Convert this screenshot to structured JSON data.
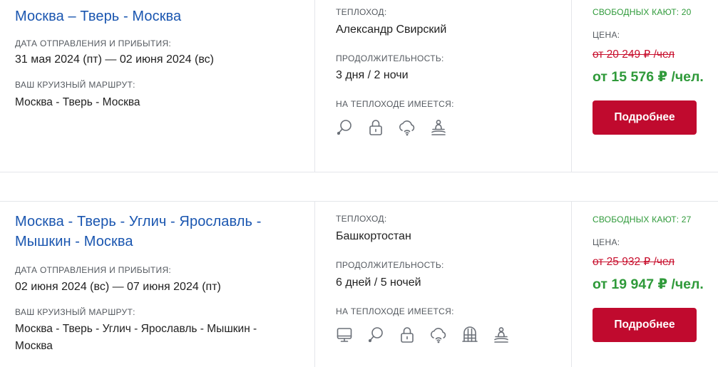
{
  "labels": {
    "dates": "ДАТА ОТПРАВЛЕНИЯ И ПРИБЫТИЯ:",
    "route": "ВАШ КРУИЗНЫЙ МАРШРУТ:",
    "ship": "ТЕПЛОХОД:",
    "duration": "ПРОДОЛЖИТЕЛЬНОСТЬ:",
    "amenities": "НА ТЕПЛОХОДЕ ИМЕЕТСЯ:",
    "price": "ЦЕНА:",
    "details_button": "Подробнее"
  },
  "cruises": [
    {
      "title": "Москва – Тверь - Москва",
      "dates": "31 мая 2024 (пт) — 02 июня 2024 (вс)",
      "route": "Москва - Тверь - Москва",
      "ship": "Александр Свирский",
      "duration": "3 дня / 2 ночи",
      "amenities": [
        "ping-pong-icon",
        "locker-icon",
        "wifi-icon",
        "meditation-icon"
      ],
      "free_cabins": "СВОБОДНЫХ КАЮТ: 20",
      "old_price": "от 20 249 ₽ /чел",
      "new_price": "от 15 576 ₽ /чел."
    },
    {
      "title_line1": "Москва - Тверь - Углич - Ярославль -",
      "title_line2": "Мышкин - Москва",
      "dates": "02 июня 2024 (вс) — 07 июня 2024 (пт)",
      "route_line1": "Москва - Тверь - Углич - Ярославль - Мышкин -",
      "route_line2": "Москва",
      "ship": "Башкортостан",
      "duration": "6 дней / 5 ночей",
      "amenities": [
        "cinema-icon",
        "ping-pong-icon",
        "locker-icon",
        "wifi-icon",
        "gym-icon",
        "meditation-icon"
      ],
      "free_cabins": "СВОБОДНЫХ КАЮТ: 27",
      "old_price": "от 25 932 ₽ /чел",
      "new_price": "от 19 947 ₽ /чел."
    }
  ],
  "colors": {
    "title": "#1a56b0",
    "free_cabins": "#2f9a3a",
    "old_price": "#c8102e",
    "new_price": "#2f9a3a",
    "button": "#c00a2e"
  }
}
